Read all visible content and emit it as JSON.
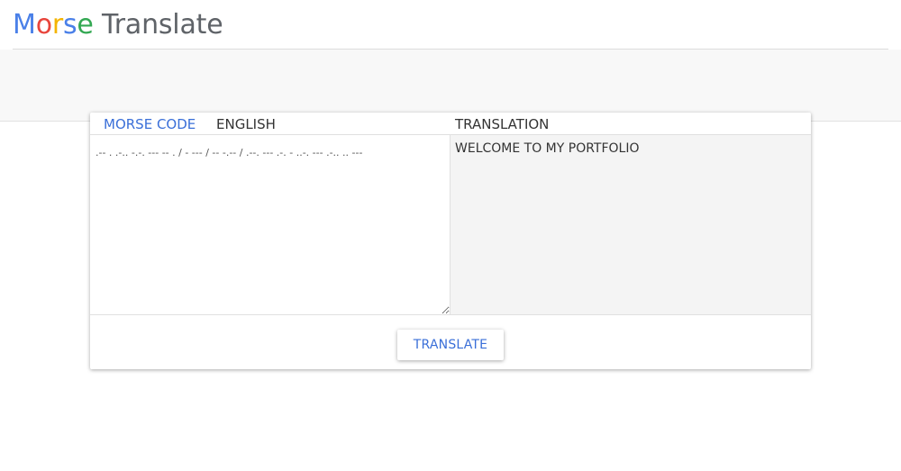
{
  "header": {
    "logo": {
      "letters": [
        "M",
        "o",
        "r",
        "s",
        "e"
      ],
      "rest": "Translate",
      "colors": [
        "#4a80e8",
        "#e8453c",
        "#f4b400",
        "#4a80e8",
        "#34a853"
      ]
    }
  },
  "translator": {
    "tabs": [
      {
        "label": "MORSE CODE",
        "active": true
      },
      {
        "label": "ENGLISH",
        "active": false
      }
    ],
    "translation_label": "TRANSLATION",
    "input_value": ".-- . .-.. -.-. --- -- . / - --- / -- -.-- / .--. --- .-. - ..-. --- .-.. .. ---",
    "output_value": "WELCOME TO MY PORTFOLIO",
    "translate_button": "TRANSLATE"
  },
  "colors": {
    "accent": "#3a6fd8",
    "band": "#f8f8f8",
    "output_bg": "#f4f4f4"
  }
}
